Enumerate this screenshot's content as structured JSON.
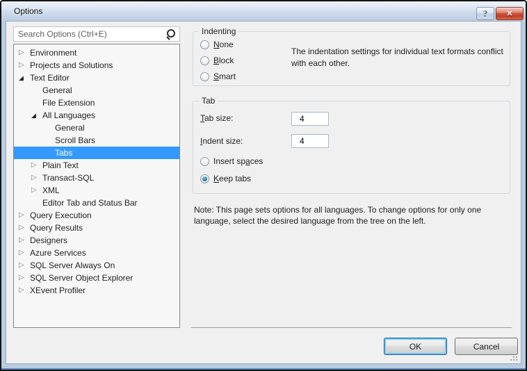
{
  "window": {
    "title": "Options",
    "help_glyph": "?",
    "close_glyph": "✕"
  },
  "search": {
    "placeholder": "Search Options (Ctrl+E)"
  },
  "tree": {
    "glyphs": {
      "collapsed": "▷",
      "expanded": "◢",
      "leaf": ""
    },
    "items": [
      {
        "label": "Environment",
        "level": 0,
        "state": "collapsed",
        "selected": false
      },
      {
        "label": "Projects and Solutions",
        "level": 0,
        "state": "collapsed",
        "selected": false
      },
      {
        "label": "Text Editor",
        "level": 0,
        "state": "expanded",
        "selected": false
      },
      {
        "label": "General",
        "level": 1,
        "state": "leaf",
        "selected": false
      },
      {
        "label": "File Extension",
        "level": 1,
        "state": "leaf",
        "selected": false
      },
      {
        "label": "All Languages",
        "level": 1,
        "state": "expanded",
        "selected": false
      },
      {
        "label": "General",
        "level": 2,
        "state": "leaf",
        "selected": false
      },
      {
        "label": "Scroll Bars",
        "level": 2,
        "state": "leaf",
        "selected": false
      },
      {
        "label": "Tabs",
        "level": 2,
        "state": "leaf",
        "selected": true
      },
      {
        "label": "Plain Text",
        "level": 1,
        "state": "collapsed",
        "selected": false
      },
      {
        "label": "Transact-SQL",
        "level": 1,
        "state": "collapsed",
        "selected": false
      },
      {
        "label": "XML",
        "level": 1,
        "state": "collapsed",
        "selected": false
      },
      {
        "label": "Editor Tab and Status Bar",
        "level": 1,
        "state": "leaf",
        "selected": false
      },
      {
        "label": "Query Execution",
        "level": 0,
        "state": "collapsed",
        "selected": false
      },
      {
        "label": "Query Results",
        "level": 0,
        "state": "collapsed",
        "selected": false
      },
      {
        "label": "Designers",
        "level": 0,
        "state": "collapsed",
        "selected": false
      },
      {
        "label": "Azure Services",
        "level": 0,
        "state": "collapsed",
        "selected": false
      },
      {
        "label": "SQL Server Always On",
        "level": 0,
        "state": "collapsed",
        "selected": false
      },
      {
        "label": "SQL Server Object Explorer",
        "level": 0,
        "state": "collapsed",
        "selected": false
      },
      {
        "label": "XEvent Profiler",
        "level": 0,
        "state": "collapsed",
        "selected": false
      }
    ]
  },
  "indenting": {
    "title": "Indenting",
    "radios": [
      {
        "pre": "",
        "key": "N",
        "post": "one",
        "selected": false
      },
      {
        "pre": "",
        "key": "B",
        "post": "lock",
        "selected": false
      },
      {
        "pre": "",
        "key": "S",
        "post": "mart",
        "selected": false
      }
    ],
    "warning": "The indentation settings for individual text formats conflict with each other."
  },
  "tab": {
    "title": "Tab",
    "fields": [
      {
        "pre": "",
        "key": "T",
        "post": "ab size:",
        "value": "4"
      },
      {
        "pre": "",
        "key": "I",
        "post": "ndent size:",
        "value": "4"
      }
    ],
    "radios": [
      {
        "pre": "Insert sp",
        "key": "a",
        "post": "ces",
        "selected": false
      },
      {
        "pre": "",
        "key": "K",
        "post": "eep tabs",
        "selected": true
      }
    ]
  },
  "note": {
    "text": "Note: This page sets options for all languages. To change options for only one language, select the desired language from the tree on the left."
  },
  "footer": {
    "ok_label": "OK",
    "cancel_label": "Cancel"
  },
  "colors": {
    "tree_selection": "#3399ff",
    "close_button_red": "#cc4f38",
    "default_button_glow": "#6fc9f2",
    "frame_blue": "#b9cce1"
  }
}
